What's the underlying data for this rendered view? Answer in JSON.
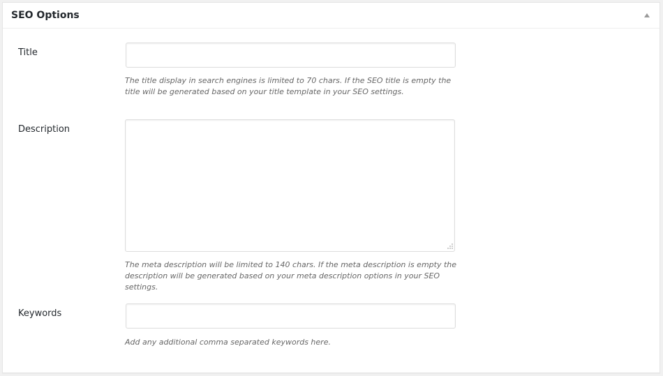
{
  "panel": {
    "title": "SEO Options",
    "toggle_icon": "triangle-up-icon"
  },
  "fields": {
    "title": {
      "label": "Title",
      "value": "",
      "help": "The title display in search engines is limited to 70 chars. If the SEO title is empty the title will be generated based on your title template in your SEO settings."
    },
    "description": {
      "label": "Description",
      "value": "",
      "help": "The meta description will be limited to 140 chars. If the meta description is empty the description will be generated based on your meta description options in your SEO settings."
    },
    "keywords": {
      "label": "Keywords",
      "value": "",
      "help": "Add any additional comma separated keywords here."
    }
  },
  "colors": {
    "panel_background": "#ffffff",
    "page_background": "#f1f1f1",
    "border": "#dddddd",
    "help_text": "#666666"
  }
}
